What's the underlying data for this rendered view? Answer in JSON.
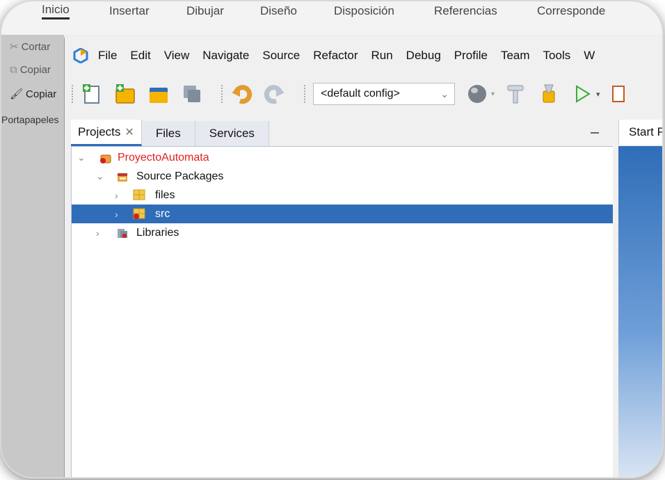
{
  "word": {
    "ribbon_tabs": [
      "Inicio",
      "Insertar",
      "Dibujar",
      "Diseño",
      "Disposición",
      "Referencias",
      "Corresponde"
    ],
    "clipboard_items": [
      "Cortar",
      "Copiar",
      "Copiar"
    ],
    "clipboard_group": "Portapapeles"
  },
  "netbeans": {
    "menu": [
      "File",
      "Edit",
      "View",
      "Navigate",
      "Source",
      "Refactor",
      "Run",
      "Debug",
      "Profile",
      "Team",
      "Tools",
      "W"
    ],
    "toolbar": {
      "config_value": "<default config>"
    },
    "tabs": [
      {
        "label": "Projects",
        "active": true,
        "closable": true
      },
      {
        "label": "Files",
        "active": false,
        "closable": false
      },
      {
        "label": "Services",
        "active": false,
        "closable": false
      }
    ],
    "start_tab": "Start P",
    "tree": [
      {
        "label": "ProyectoAutomata",
        "level": 0,
        "expanded": true,
        "icon": "project-icon",
        "selected": false
      },
      {
        "label": "Source Packages",
        "level": 1,
        "expanded": true,
        "icon": "source-packages-icon",
        "selected": false
      },
      {
        "label": "files",
        "level": 2,
        "expanded": false,
        "icon": "package-icon",
        "selected": false
      },
      {
        "label": "src",
        "level": 2,
        "expanded": false,
        "icon": "package-error-icon",
        "selected": true
      },
      {
        "label": "Libraries",
        "level": 1,
        "expanded": false,
        "icon": "libraries-icon",
        "selected": false
      }
    ],
    "colors": {
      "selection": "#2f6db8",
      "project_error_text": "#e02020"
    }
  }
}
